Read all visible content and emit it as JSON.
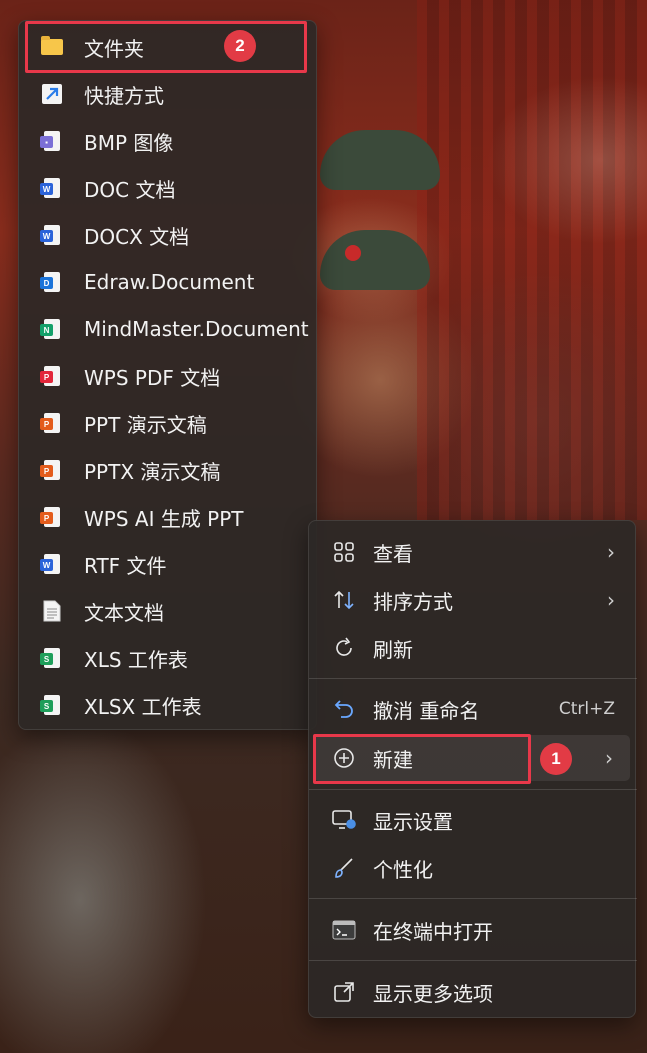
{
  "submenu": {
    "items": [
      {
        "label": "文件夹",
        "icon": "folder-icon"
      },
      {
        "label": "快捷方式",
        "icon": "shortcut-arrow-icon"
      },
      {
        "label": "BMP 图像",
        "icon": "bmp-image-icon"
      },
      {
        "label": "DOC 文档",
        "icon": "word-doc-icon"
      },
      {
        "label": "DOCX 文档",
        "icon": "word-docx-icon"
      },
      {
        "label": "Edraw.Document",
        "icon": "edraw-document-icon"
      },
      {
        "label": "MindMaster.Document",
        "icon": "mindmaster-document-icon"
      },
      {
        "label": "WPS PDF 文档",
        "icon": "wps-pdf-icon"
      },
      {
        "label": "PPT 演示文稿",
        "icon": "ppt-icon"
      },
      {
        "label": "PPTX 演示文稿",
        "icon": "pptx-icon"
      },
      {
        "label": "WPS AI 生成 PPT",
        "icon": "wps-ai-ppt-icon"
      },
      {
        "label": "RTF 文件",
        "icon": "rtf-icon"
      },
      {
        "label": "文本文档",
        "icon": "text-document-icon"
      },
      {
        "label": "XLS 工作表",
        "icon": "xls-icon"
      },
      {
        "label": "XLSX 工作表",
        "icon": "xlsx-icon"
      }
    ]
  },
  "mainmenu": {
    "items": [
      {
        "label": "查看",
        "icon": "grid-view-icon",
        "chevron": "›"
      },
      {
        "label": "排序方式",
        "icon": "sort-icon",
        "chevron": "›"
      },
      {
        "label": "刷新",
        "icon": "refresh-icon"
      },
      {
        "label": "撤消 重命名",
        "icon": "undo-icon",
        "shortcut": "Ctrl+Z"
      },
      {
        "label": "新建",
        "icon": "new-plus-icon",
        "chevron": "›"
      },
      {
        "label": "显示设置",
        "icon": "display-settings-icon"
      },
      {
        "label": "个性化",
        "icon": "personalize-brush-icon"
      },
      {
        "label": "在终端中打开",
        "icon": "terminal-icon"
      },
      {
        "label": "显示更多选项",
        "icon": "more-options-icon"
      }
    ]
  },
  "annotations": {
    "badge_1": "1",
    "badge_2": "2",
    "highlight_color": "#e8384a"
  },
  "colors": {
    "word_blue": "#2b63d9",
    "ppt_orange": "#e35c1c",
    "excel_green": "#1e9e5a",
    "pdf_red": "#e2263a",
    "folder_yellow": "#f7c64a"
  }
}
